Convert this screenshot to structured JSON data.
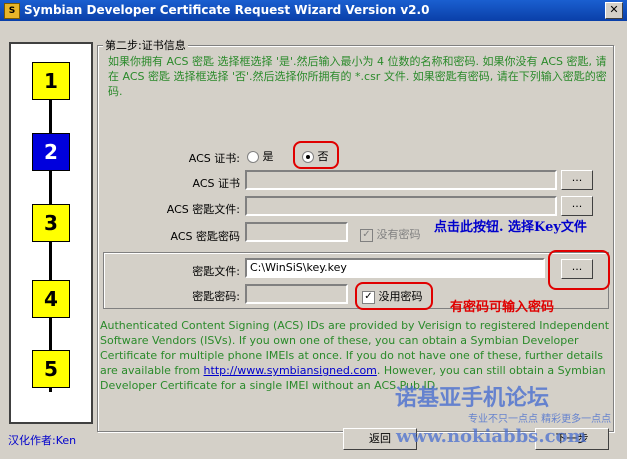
{
  "window": {
    "title": "Symbian Developer Certificate Request Wizard Version v2.0",
    "close_glyph": "✕"
  },
  "steps": [
    "1",
    "2",
    "3",
    "4",
    "5"
  ],
  "group": {
    "title": "第二步:证书信息",
    "intro": "如果你拥有 ACS 密匙 选择框选择 '是'.然后输入最小为 4 位数的名称和密码. 如果你没有 ACS 密匙, 请在 ACS 密匙 选择框选择 '否'.然后选择你所拥有的 *.csr 文件. 如果密匙有密码, 请在下列输入密匙的密码."
  },
  "acs": {
    "cert_label": "ACS 证书:",
    "yes_label": "是",
    "no_label": "否",
    "selected": "no",
    "cert_file_label": "ACS 证书",
    "key_file_label": "ACS 密匙文件:",
    "key_password_label": "ACS 密匙密码",
    "no_password_label": "没有密码",
    "browse_label": "..."
  },
  "key": {
    "file_label": "密匙文件:",
    "file_value": "C:\\WinSiS\\key.key",
    "password_label": "密匙密码:",
    "no_password_label": "没用密码",
    "no_password_checked": true,
    "browse_label": "..."
  },
  "annotations": {
    "browse_hint": "点击此按钮. 选择Key文件",
    "password_hint": "有密码可输入密码"
  },
  "info": {
    "text_before_link": "Authenticated Content Signing (ACS) IDs are provided by Verisign to registered Independent Software Vendors (ISVs). If you own one of these, you can obtain a Symbian Developer Certificate for multiple phone IMEIs at once. If you do not have one of these, further details are available from ",
    "link": "http://www.symbiansigned.com",
    "text_after_link": ". However, you can still obtain a Symbian Developer Certificate for a single IMEI without an ACS Pub ID."
  },
  "footer": {
    "credit": "汉化作者:Ken",
    "back_label": "返回",
    "next_label": "下一步"
  },
  "watermark": {
    "line1": "诺基亚手机论坛",
    "line2": "专业不只一点点 精彩更多一点点",
    "line3": "www.nokiabbs.com"
  }
}
